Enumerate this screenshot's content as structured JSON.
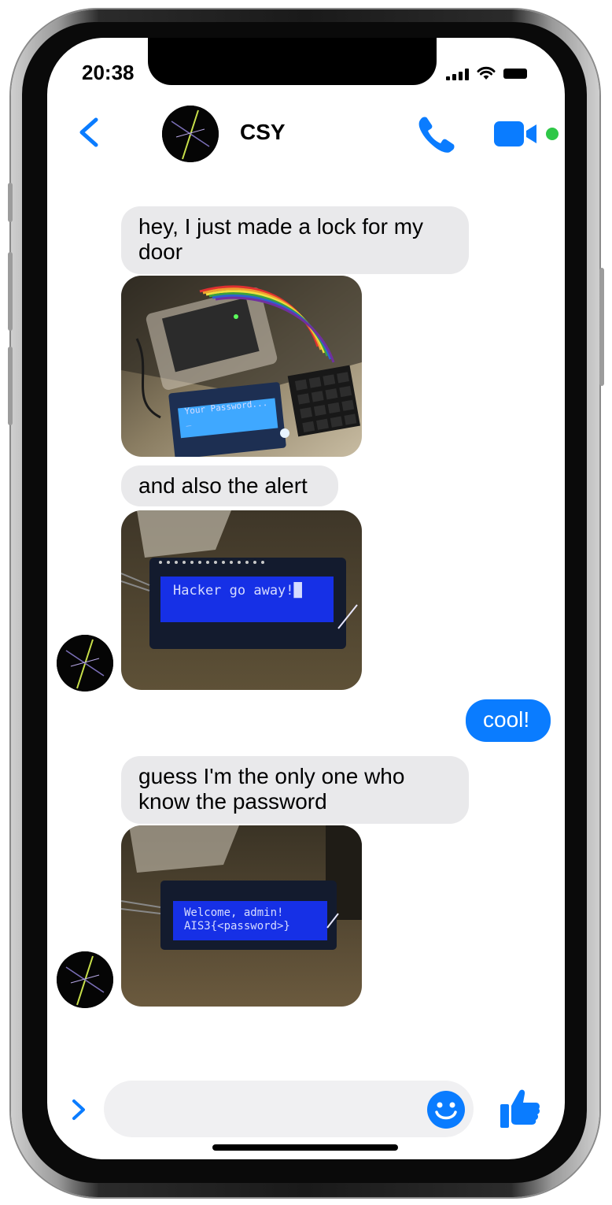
{
  "status_bar": {
    "time": "20:38"
  },
  "header": {
    "contact_name": "CSY"
  },
  "messages": [
    {
      "from": "them",
      "text": "hey, I just made a lock for my door"
    },
    {
      "from": "them",
      "type": "photo",
      "lcd_text": "Your Password...\n_"
    },
    {
      "from": "them",
      "text": "and also the alert"
    },
    {
      "from": "them",
      "type": "photo",
      "lcd_text": "Hacker go away!█"
    },
    {
      "from": "me",
      "text": "cool!"
    },
    {
      "from": "them",
      "text": "guess I'm the only one who know the password"
    },
    {
      "from": "them",
      "type": "photo",
      "lcd_text": "Welcome, admin!\nAIS3{<password>}"
    }
  ],
  "composer": {
    "placeholder": ""
  },
  "icons": {
    "back": "chevron-left-icon",
    "call": "phone-icon",
    "video": "video-camera-icon",
    "more": "chevron-right-icon",
    "emoji": "smiley-icon",
    "like": "thumbs-up-icon"
  },
  "colors": {
    "accent": "#0a7cff",
    "incoming_bubble": "#e9e9eb",
    "online": "#2ec747"
  }
}
